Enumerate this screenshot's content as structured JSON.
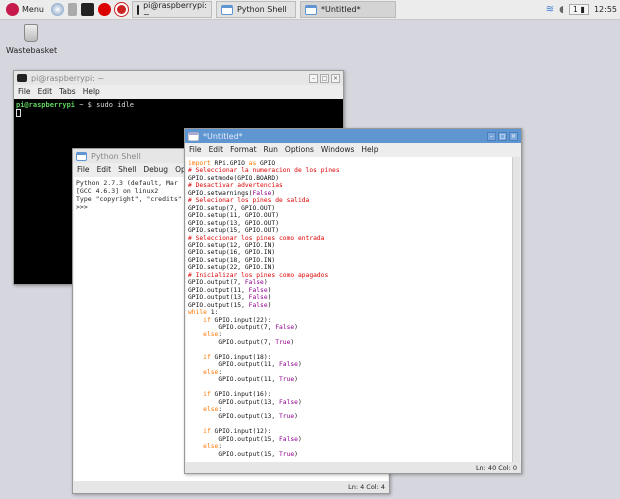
{
  "taskbar": {
    "menu_label": "Menu",
    "tasks": [
      "pi@raspberrypi: ~",
      "Python Shell",
      "*Untitled*"
    ],
    "workspace": "1",
    "clock": "12:55",
    "icons": [
      "raspberry-icon",
      "browser-icon",
      "file-manager-icon",
      "terminal-icon",
      "wolfram-icon",
      "mathematica-icon",
      "wifi-icon",
      "volume-icon",
      "cpu-icon"
    ]
  },
  "desktop": {
    "wastebasket": "Wastebasket"
  },
  "terminal": {
    "title": "pi@raspberrypi: ~",
    "menu": [
      "File",
      "Edit",
      "Tabs",
      "Help"
    ],
    "prompt": "pi@raspberrypi",
    "prompt_rest": " ~ $ sudo idle"
  },
  "shell": {
    "title": "Python Shell",
    "menu": [
      "File",
      "Edit",
      "Shell",
      "Debug",
      "Options"
    ],
    "lines": [
      "Python 2.7.3 (default, Mar",
      "[GCC 4.6.3] on linux2",
      "Type \"copyright\", \"credits\"",
      ">>> "
    ],
    "status": "Ln: 4 Col: 4"
  },
  "editor": {
    "title": "*Untitled*",
    "menu": [
      "File",
      "Edit",
      "Format",
      "Run",
      "Options",
      "Windows",
      "Help"
    ],
    "status": "Ln: 40 Col: 0",
    "colors": {
      "keyword": "#ff7700",
      "comment": "#dd0000",
      "builtin": "#900090"
    },
    "code": [
      [
        [
          "import",
          "k"
        ],
        [
          " RPi.GPIO ",
          "n"
        ],
        [
          "as",
          "k"
        ],
        [
          " GPIO",
          "n"
        ]
      ],
      [
        [
          "# Seleccionar la numeracion de los pines",
          "c"
        ]
      ],
      [
        [
          "GPIO.setmode(GPIO.BOARD)",
          "n"
        ]
      ],
      [
        [
          "# Desactivar advertencias",
          "c"
        ]
      ],
      [
        [
          "GPIO.setwarnings(",
          "n"
        ],
        [
          "False",
          "b"
        ],
        [
          ")",
          "n"
        ]
      ],
      [
        [
          "# Selecionar los pines de salida",
          "c"
        ]
      ],
      [
        [
          "GPIO.setup(7, GPIO.OUT)",
          "n"
        ]
      ],
      [
        [
          "GPIO.setup(11, GPIO.OUT)",
          "n"
        ]
      ],
      [
        [
          "GPIO.setup(13, GPIO.OUT)",
          "n"
        ]
      ],
      [
        [
          "GPIO.setup(15, GPIO.OUT)",
          "n"
        ]
      ],
      [
        [
          "# Seleccionar los pines como entrada",
          "c"
        ]
      ],
      [
        [
          "GPIO.setup(12, GPIO.IN)",
          "n"
        ]
      ],
      [
        [
          "GPIO.setup(16, GPIO.IN)",
          "n"
        ]
      ],
      [
        [
          "GPIO.setup(18, GPIO.IN)",
          "n"
        ]
      ],
      [
        [
          "GPIO.setup(22, GPIO.IN)",
          "n"
        ]
      ],
      [
        [
          "# Inicializar los pines como apagados",
          "c"
        ]
      ],
      [
        [
          "GPIO.output(7, ",
          "n"
        ],
        [
          "False",
          "b"
        ],
        [
          ")",
          "n"
        ]
      ],
      [
        [
          "GPIO.output(11, ",
          "n"
        ],
        [
          "False",
          "b"
        ],
        [
          ")",
          "n"
        ]
      ],
      [
        [
          "GPIO.output(13, ",
          "n"
        ],
        [
          "False",
          "b"
        ],
        [
          ")",
          "n"
        ]
      ],
      [
        [
          "GPIO.output(15, ",
          "n"
        ],
        [
          "False",
          "b"
        ],
        [
          ")",
          "n"
        ]
      ],
      [
        [
          "while",
          "k"
        ],
        [
          " 1:",
          "n"
        ]
      ],
      [
        [
          "    ",
          "n"
        ],
        [
          "if",
          "k"
        ],
        [
          " GPIO.input(22):",
          "n"
        ]
      ],
      [
        [
          "        GPIO.output(7, ",
          "n"
        ],
        [
          "False",
          "b"
        ],
        [
          ")",
          "n"
        ]
      ],
      [
        [
          "    ",
          "n"
        ],
        [
          "else",
          "k"
        ],
        [
          ":",
          "n"
        ]
      ],
      [
        [
          "        GPIO.output(7, ",
          "n"
        ],
        [
          "True",
          "b"
        ],
        [
          ")",
          "n"
        ]
      ],
      [
        [
          "",
          "n"
        ]
      ],
      [
        [
          "    ",
          "n"
        ],
        [
          "if",
          "k"
        ],
        [
          " GPIO.input(18):",
          "n"
        ]
      ],
      [
        [
          "        GPIO.output(11, ",
          "n"
        ],
        [
          "False",
          "b"
        ],
        [
          ")",
          "n"
        ]
      ],
      [
        [
          "    ",
          "n"
        ],
        [
          "else",
          "k"
        ],
        [
          ":",
          "n"
        ]
      ],
      [
        [
          "        GPIO.output(11, ",
          "n"
        ],
        [
          "True",
          "b"
        ],
        [
          ")",
          "n"
        ]
      ],
      [
        [
          "",
          "n"
        ]
      ],
      [
        [
          "    ",
          "n"
        ],
        [
          "if",
          "k"
        ],
        [
          " GPIO.input(16):",
          "n"
        ]
      ],
      [
        [
          "        GPIO.output(13, ",
          "n"
        ],
        [
          "False",
          "b"
        ],
        [
          ")",
          "n"
        ]
      ],
      [
        [
          "    ",
          "n"
        ],
        [
          "else",
          "k"
        ],
        [
          ":",
          "n"
        ]
      ],
      [
        [
          "        GPIO.output(13, ",
          "n"
        ],
        [
          "True",
          "b"
        ],
        [
          ")",
          "n"
        ]
      ],
      [
        [
          "",
          "n"
        ]
      ],
      [
        [
          "    ",
          "n"
        ],
        [
          "if",
          "k"
        ],
        [
          " GPIO.input(12):",
          "n"
        ]
      ],
      [
        [
          "        GPIO.output(15, ",
          "n"
        ],
        [
          "False",
          "b"
        ],
        [
          ")",
          "n"
        ]
      ],
      [
        [
          "    ",
          "n"
        ],
        [
          "else",
          "k"
        ],
        [
          ":",
          "n"
        ]
      ],
      [
        [
          "        GPIO.output(15, ",
          "n"
        ],
        [
          "True",
          "b"
        ],
        [
          ")",
          "n"
        ]
      ]
    ]
  }
}
